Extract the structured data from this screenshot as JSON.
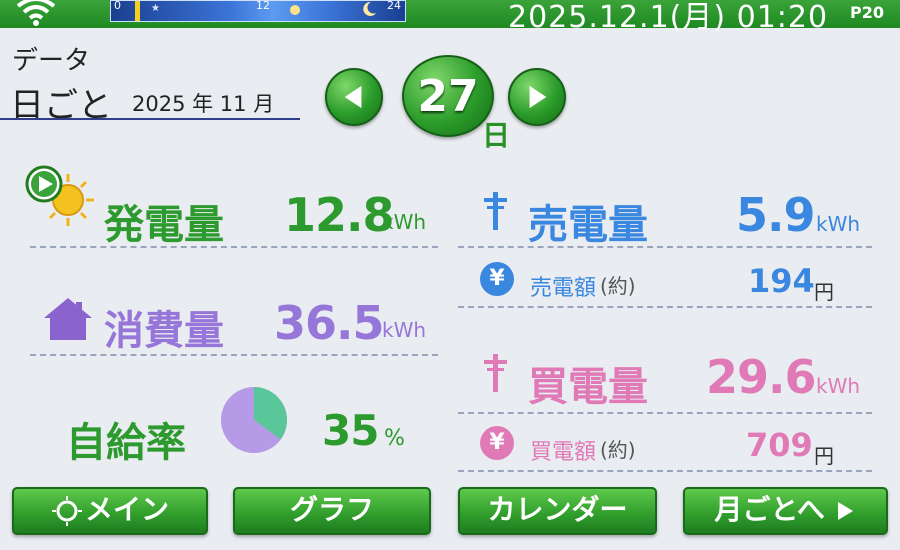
{
  "status_bar": {
    "timeline_ticks": [
      "0",
      "12",
      "24"
    ],
    "datetime": "2025.12.1(月) 01:20",
    "page": "P20"
  },
  "header": {
    "section": "データ",
    "mode": "日ごと",
    "year_month": "2025 年 11 月",
    "day": "27",
    "day_unit": "日"
  },
  "metrics": {
    "generation": {
      "label": "発電量",
      "value": "12.8",
      "unit": "kWh"
    },
    "consumption": {
      "label": "消費量",
      "value": "36.5",
      "unit": "kWh"
    },
    "self_sufficiency": {
      "label": "自給率",
      "value": "35",
      "unit": "%",
      "fraction": 0.35
    },
    "sold": {
      "label": "売電量",
      "value": "5.9",
      "unit": "kWh"
    },
    "sold_amount": {
      "label": "売電額",
      "note": "(約)",
      "value": "194",
      "unit": "円",
      "icon": "¥"
    },
    "bought": {
      "label": "買電量",
      "value": "29.6",
      "unit": "kWh"
    },
    "bought_amount": {
      "label": "買電額",
      "note": "(約)",
      "value": "709",
      "unit": "円",
      "icon": "¥"
    }
  },
  "nav": {
    "main": "メイン",
    "graph": "グラフ",
    "calendar": "カレンダー",
    "monthly": "月ごとへ"
  },
  "colors": {
    "generation": "#2c9a2e",
    "consumption": "#9676d8",
    "sold": "#3a87e0",
    "bought": "#e07ab6",
    "accent": "#2a9b2a"
  },
  "icons": [
    "wifi-icon",
    "sun-icon",
    "house-icon",
    "power-pole-icon",
    "yen-icon",
    "play-icon",
    "chevron-left-icon",
    "chevron-right-icon",
    "moon-icon"
  ]
}
